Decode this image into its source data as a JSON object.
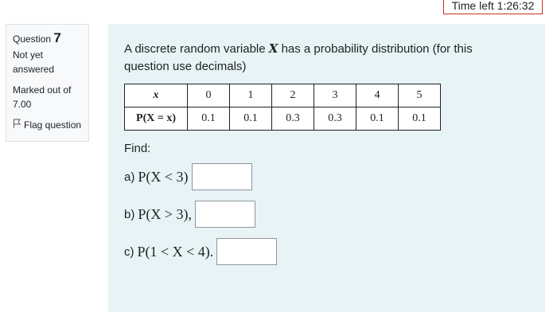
{
  "timer": {
    "text": "Time left 1:26:32"
  },
  "info": {
    "question_label": "Question",
    "question_number": "7",
    "state": "Not yet answered",
    "grade": "Marked out of 7.00",
    "flag_label": "Flag question"
  },
  "question": {
    "text_before_var": "A discrete random variable ",
    "variable": "X",
    "text_after_var": " has a probability distribution  (for this question use decimals)",
    "table": {
      "header_x": "x",
      "header_p": "P(X = x)",
      "x_values": [
        "0",
        "1",
        "2",
        "3",
        "4",
        "5"
      ],
      "p_values": [
        "0.1",
        "0.1",
        "0.3",
        "0.3",
        "0.1",
        "0.1"
      ]
    },
    "find_label": "Find:",
    "parts": [
      {
        "label": "a)",
        "math": "P(X < 3)",
        "value": ""
      },
      {
        "label": "b)",
        "math": "P(X > 3),",
        "value": ""
      },
      {
        "label": "c)",
        "math": "P(1 < X < 4).",
        "value": ""
      }
    ]
  }
}
